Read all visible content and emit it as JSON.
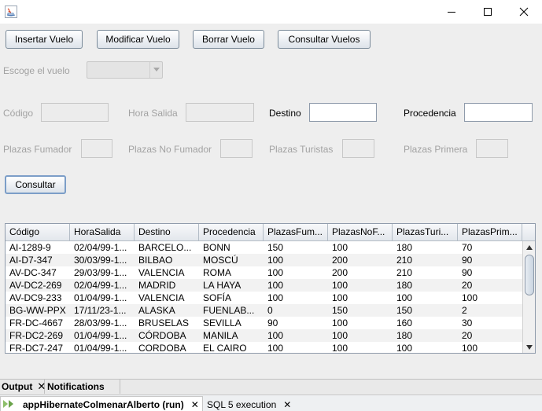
{
  "window": {
    "minimize_icon": "minimize-icon",
    "maximize_icon": "maximize-icon",
    "close_icon": "close-icon",
    "app_icon": "java-icon"
  },
  "toolbar": {
    "insert_label": "Insertar Vuelo",
    "modify_label": "Modificar Vuelo",
    "delete_label": "Borrar Vuelo",
    "query_label": "Consultar Vuelos"
  },
  "flight_select": {
    "label": "Escoge el vuelo",
    "value": ""
  },
  "form": {
    "codigo_label": "Código",
    "codigo_value": "",
    "hora_salida_label": "Hora Salida",
    "hora_salida_value": "",
    "destino_label": "Destino",
    "destino_value": "",
    "procedencia_label": "Procedencia",
    "procedencia_value": "",
    "plazas_fumador_label": "Plazas Fumador",
    "plazas_fumador_value": "",
    "plazas_no_fumador_label": "Plazas No Fumador",
    "plazas_no_fumador_value": "",
    "plazas_turistas_label": "Plazas Turistas",
    "plazas_turistas_value": "",
    "plazas_primera_label": "Plazas Primera",
    "plazas_primera_value": ""
  },
  "consultar_label": "Consultar",
  "table": {
    "columns": [
      "Código",
      "HoraSalida",
      "Destino",
      "Procedencia",
      "PlazasFum...",
      "PlazasNoF...",
      "PlazasTuri...",
      "PlazasPrim..."
    ],
    "rows": [
      [
        "AI-1289-9",
        "02/04/99-1...",
        "BARCELO...",
        "BONN",
        "150",
        "100",
        "180",
        "70"
      ],
      [
        "AI-D7-347",
        "30/03/99-1...",
        "BILBAO",
        "MOSCÚ",
        "100",
        "200",
        "210",
        "90"
      ],
      [
        "AV-DC-347",
        "29/03/99-1...",
        "VALENCIA",
        "ROMA",
        "100",
        "200",
        "210",
        "90"
      ],
      [
        "AV-DC2-269",
        "02/04/99-1...",
        "MADRID",
        "LA HAYA",
        "100",
        "100",
        "180",
        "20"
      ],
      [
        "AV-DC9-233",
        "01/04/99-1...",
        "VALENCIA",
        "SOFÍA",
        "100",
        "100",
        "100",
        "100"
      ],
      [
        "BG-WW-PPX",
        "17/11/23-1...",
        "ALASKA",
        "FUENLAB...",
        "0",
        "150",
        "150",
        "2"
      ],
      [
        "FR-DC-4667",
        "28/03/99-1...",
        "BRUSELAS",
        "SEVILLA",
        "90",
        "100",
        "160",
        "30"
      ],
      [
        "FR-DC2-269",
        "01/04/99-1...",
        "CÓRDOBA",
        "MANILA",
        "100",
        "100",
        "180",
        "20"
      ],
      [
        "FR-DC7-247",
        "01/04/99-1...",
        "CORDOBA",
        "EL CAIRO",
        "100",
        "100",
        "100",
        "100"
      ]
    ]
  },
  "bottom": {
    "output_tab": "Output",
    "notifications_tab": "Notifications",
    "run_tab": "appHibernateColmenarAlberto (run)",
    "sql_tab": "SQL 5 execution"
  }
}
